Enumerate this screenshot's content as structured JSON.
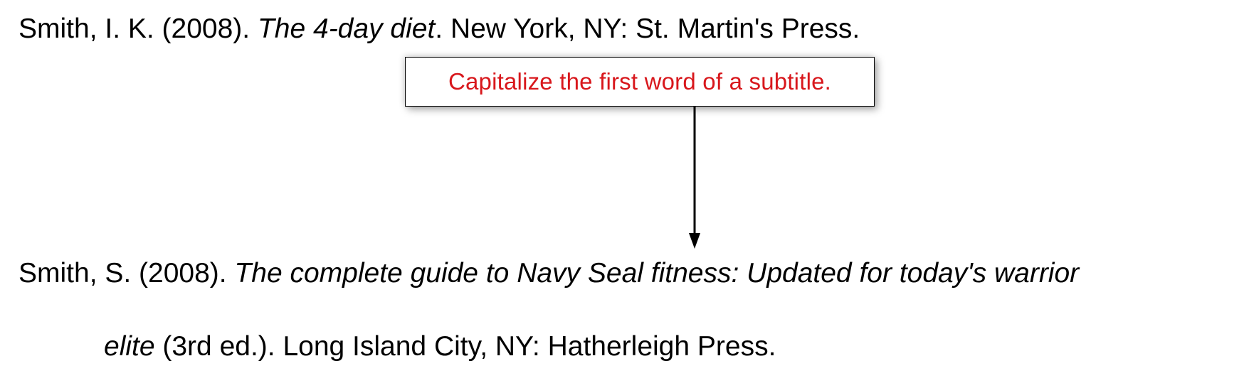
{
  "citation1": {
    "author": "Smith, I. K. (2008). ",
    "title": "The 4-day diet",
    "after_title": ". New York, NY: St. Martin's Press."
  },
  "callout": {
    "text": "Capitalize the first word of a subtitle."
  },
  "citation2": {
    "author": "Smith, S. (2008). ",
    "title": "The complete guide to Navy Seal fitness: Updated for today's warrior",
    "title_line2": "elite",
    "edition_note": " (3rd ed.). ",
    "after": "Long Island City, NY: Hatherleigh Press."
  }
}
